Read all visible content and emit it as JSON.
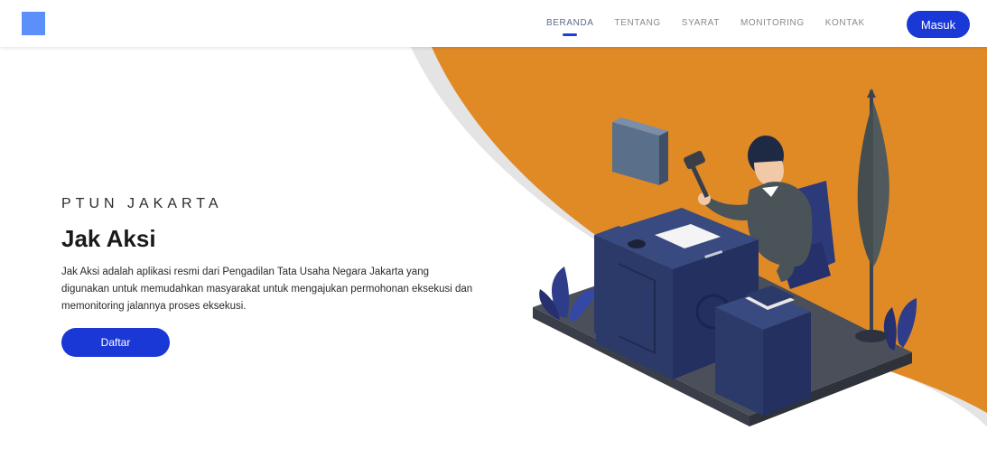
{
  "nav": {
    "links": [
      {
        "label": "BERANDA",
        "active": true
      },
      {
        "label": "TENTANG",
        "active": false
      },
      {
        "label": "SYARAT",
        "active": false
      },
      {
        "label": "MONITORING",
        "active": false
      },
      {
        "label": "KONTAK",
        "active": false
      }
    ],
    "login_label": "Masuk"
  },
  "hero": {
    "eyebrow": "PTUN JAKARTA",
    "title": "Jak Aksi",
    "description": "Jak Aksi adalah aplikasi resmi dari Pengadilan Tata Usaha Negara Jakarta yang digunakan untuk memudahkan masyarakat untuk mengajukan permohonan eksekusi dan memonitoring jalannya proses eksekusi.",
    "cta_label": "Daftar"
  },
  "colors": {
    "accent": "#1a38d6",
    "logo": "#5b8ff9",
    "orange": "#e08a26"
  },
  "icons": [
    "logo-square-icon",
    "judge-court-illustration"
  ]
}
